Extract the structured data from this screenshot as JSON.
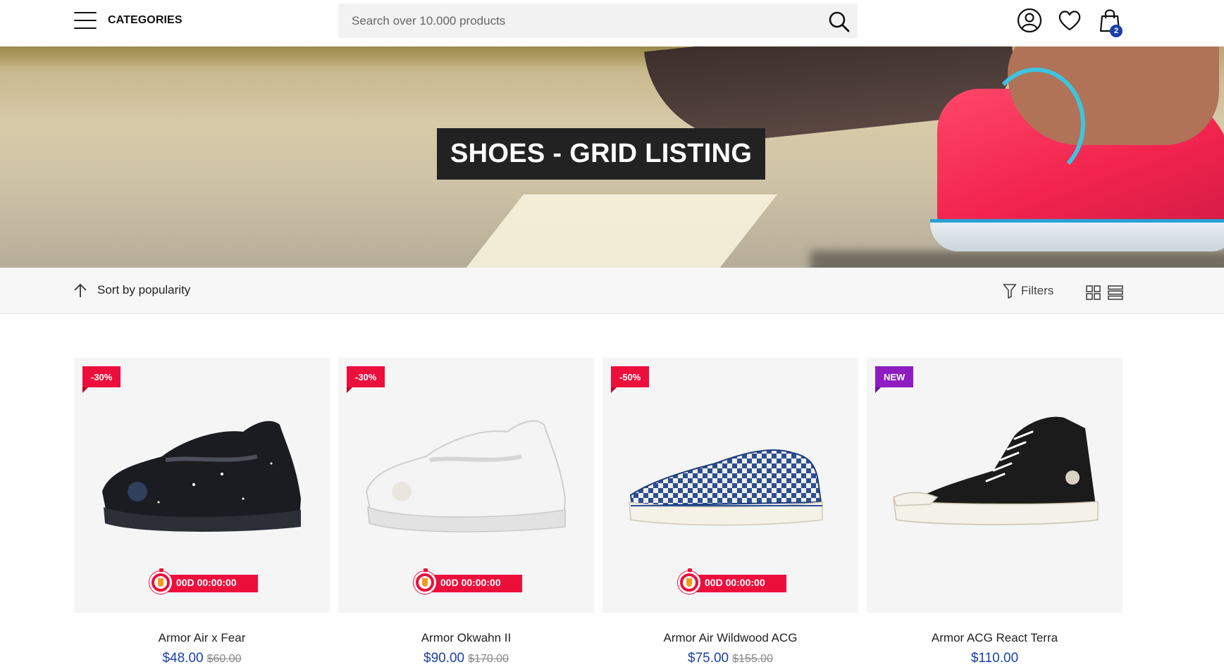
{
  "header": {
    "categories_label": "CATEGORIES",
    "search_placeholder": "Search over 10.000 products",
    "cart_count": "2",
    "icons": [
      "menu-icon",
      "search-icon",
      "user-icon",
      "heart-icon",
      "shopping-bag-icon"
    ]
  },
  "hero": {
    "title": "SHOES - GRID LISTING"
  },
  "toolbar": {
    "sort_label": "Sort by popularity",
    "filters_label": "Filters",
    "icons": [
      "arrow-up-icon",
      "filter-icon",
      "grid-view-icon",
      "list-view-icon"
    ]
  },
  "colors": {
    "sale_badge": "#ed0f3b",
    "new_badge": "#8e1cc2",
    "price": "#1c3fa8"
  },
  "products": [
    {
      "badge": "-30%",
      "name": "Armor Air x Fear",
      "price": "$48.00",
      "old_price": "$60.00",
      "timer": "00D 00:00:00"
    },
    {
      "badge": "-30%",
      "name": "Armor Okwahn II",
      "price": "$90.00",
      "old_price": "$170.00",
      "timer": "00D 00:00:00"
    },
    {
      "badge": "-50%",
      "name": "Armor Air Wildwood ACG",
      "price": "$75.00",
      "old_price": "$155.00",
      "timer": "00D 00:00:00"
    },
    {
      "badge": "NEW",
      "name": "Armor ACG React Terra",
      "price": "$110.00"
    }
  ]
}
